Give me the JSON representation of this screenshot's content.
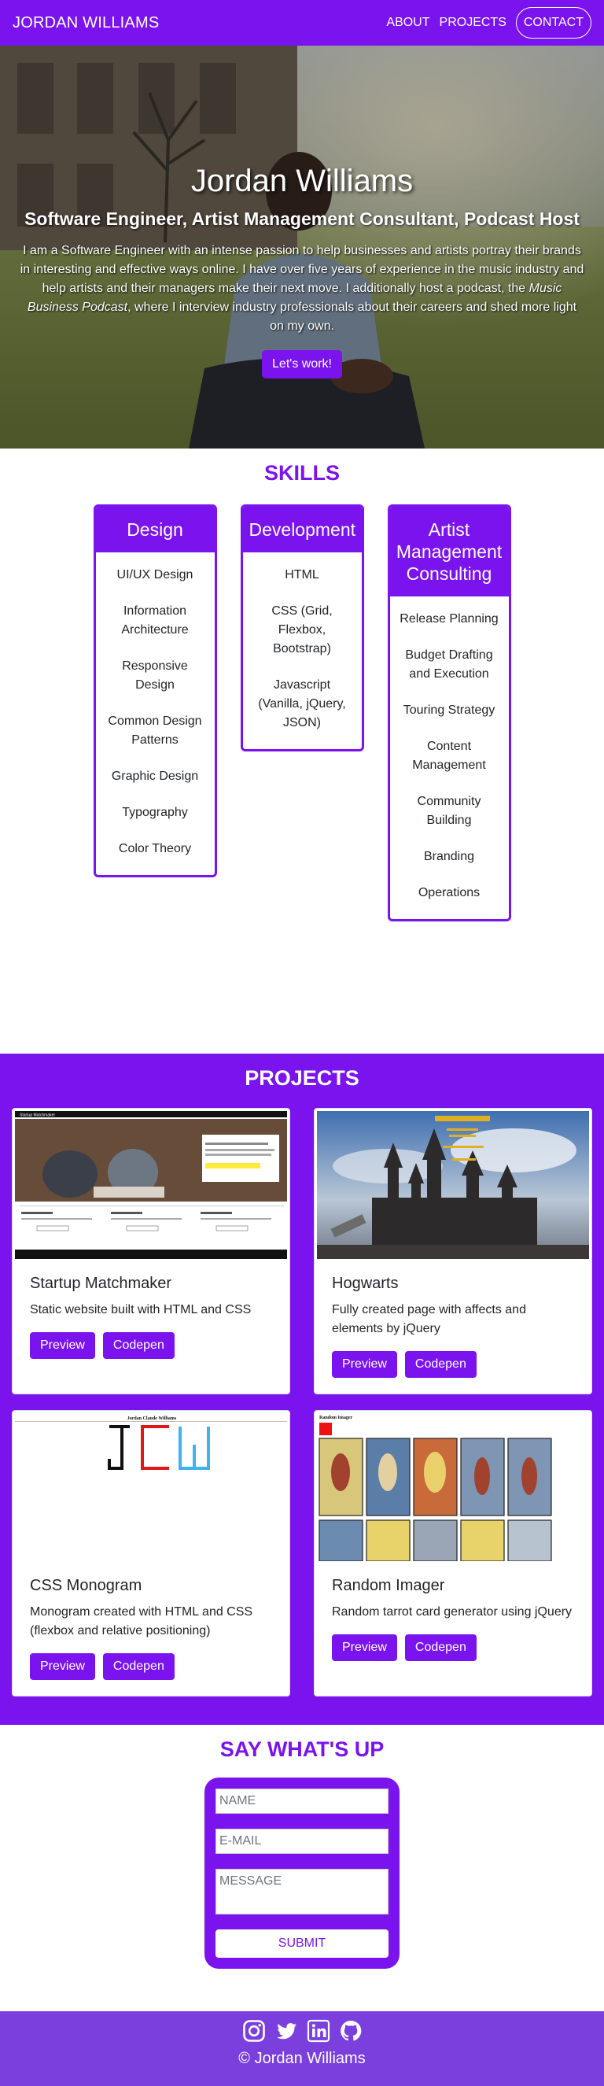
{
  "nav": {
    "brand": "JORDAN WILLIAMS",
    "links": [
      "ABOUT",
      "PROJECTS"
    ],
    "contact": "CONTACT"
  },
  "hero": {
    "title": "Jordan Williams",
    "subtitle": "Software Engineer, Artist Management Consultant, Podcast Host",
    "bio_before": "I am a Software Engineer with an intense passion to help businesses and artists portray their brands in interesting and effective ways online. I have over five years of experience in the music industry and help artists and their managers make their next move. I additionally host a podcast, the ",
    "bio_em": "Music Business Podcast",
    "bio_after": ", where I interview industry professionals about their careers and shed more light on my own.",
    "button": "Let's work!"
  },
  "skills": {
    "heading": "SKILLS",
    "columns": [
      {
        "title": "Design",
        "items": [
          "UI/UX Design",
          "Information Architecture",
          "Responsive Design",
          "Common Design Patterns",
          "Graphic Design",
          "Typography",
          "Color Theory"
        ]
      },
      {
        "title": "Development",
        "items": [
          "HTML",
          "CSS (Grid, Flexbox, Bootstrap)",
          "Javascript (Vanilla, jQuery, JSON)"
        ]
      },
      {
        "title": "Artist Management Consulting",
        "items": [
          "Release Planning",
          "Budget Drafting and Execution",
          "Touring Strategy",
          "Content Management",
          "Community Building",
          "Branding",
          "Operations"
        ]
      }
    ]
  },
  "projects": {
    "heading": "PROJECTS",
    "items": [
      {
        "title": "Startup Matchmaker",
        "desc": "Static website built with HTML and CSS",
        "preview": "Preview",
        "codepen": "Codepen"
      },
      {
        "title": "Hogwarts",
        "desc": "Fully created page with affects and elements by jQuery",
        "preview": "Preview",
        "codepen": "Codepen"
      },
      {
        "title": "CSS Monogram",
        "desc": "Monogram created with HTML and CSS (flexbox and relative positioning)",
        "preview": "Preview",
        "codepen": "Codepen"
      },
      {
        "title": "Random Imager",
        "desc": "Random tarrot card generator using jQuery",
        "preview": "Preview",
        "codepen": "Codepen"
      }
    ],
    "thumbs": {
      "startup_nav_title": "Startup Matchmaker",
      "monogram_caption": "Jordan Claude Williams",
      "monogram_letters": [
        "J",
        "C",
        "W"
      ],
      "imager_caption": "Random Imager"
    }
  },
  "contact": {
    "heading": "SAY WHAT'S UP",
    "name_placeholder": "NAME",
    "email_placeholder": "E-MAIL",
    "message_placeholder": "MESSAGE",
    "submit": "SUBMIT"
  },
  "footer": {
    "icons": [
      "instagram-icon",
      "twitter-icon",
      "linkedin-icon",
      "github-icon"
    ],
    "copyright": "© Jordan Williams"
  },
  "colors": {
    "accent": "#7a13ee",
    "footer": "#7a3fdc"
  }
}
